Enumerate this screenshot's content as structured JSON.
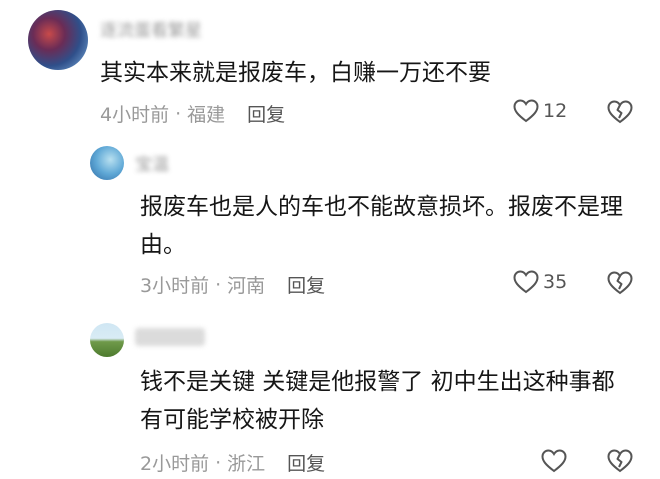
{
  "comments": [
    {
      "username": "逐流蛋看繁星",
      "text": "其实本来就是报废车，白赚一万还不要",
      "time": "4小时前",
      "separator": "·",
      "location": "福建",
      "reply_label": "回复",
      "likes": "12"
    },
    {
      "username": "宝温",
      "text": "报废车也是人的车也不能故意损坏。报废不是理由。",
      "time": "3小时前",
      "separator": "·",
      "location": "河南",
      "reply_label": "回复",
      "likes": "35"
    },
    {
      "username": "",
      "text": "钱不是关键 关键是他报警了 初中生出这种事都有可能学校被开除",
      "time": "2小时前",
      "separator": "·",
      "location": "浙江",
      "reply_label": "回复",
      "likes": ""
    }
  ],
  "icons": {
    "like": "heart-outline-icon",
    "dislike": "broken-heart-icon"
  },
  "colors": {
    "text": "#161616",
    "meta": "#999999",
    "reply": "#555555",
    "icon": "#555555"
  }
}
